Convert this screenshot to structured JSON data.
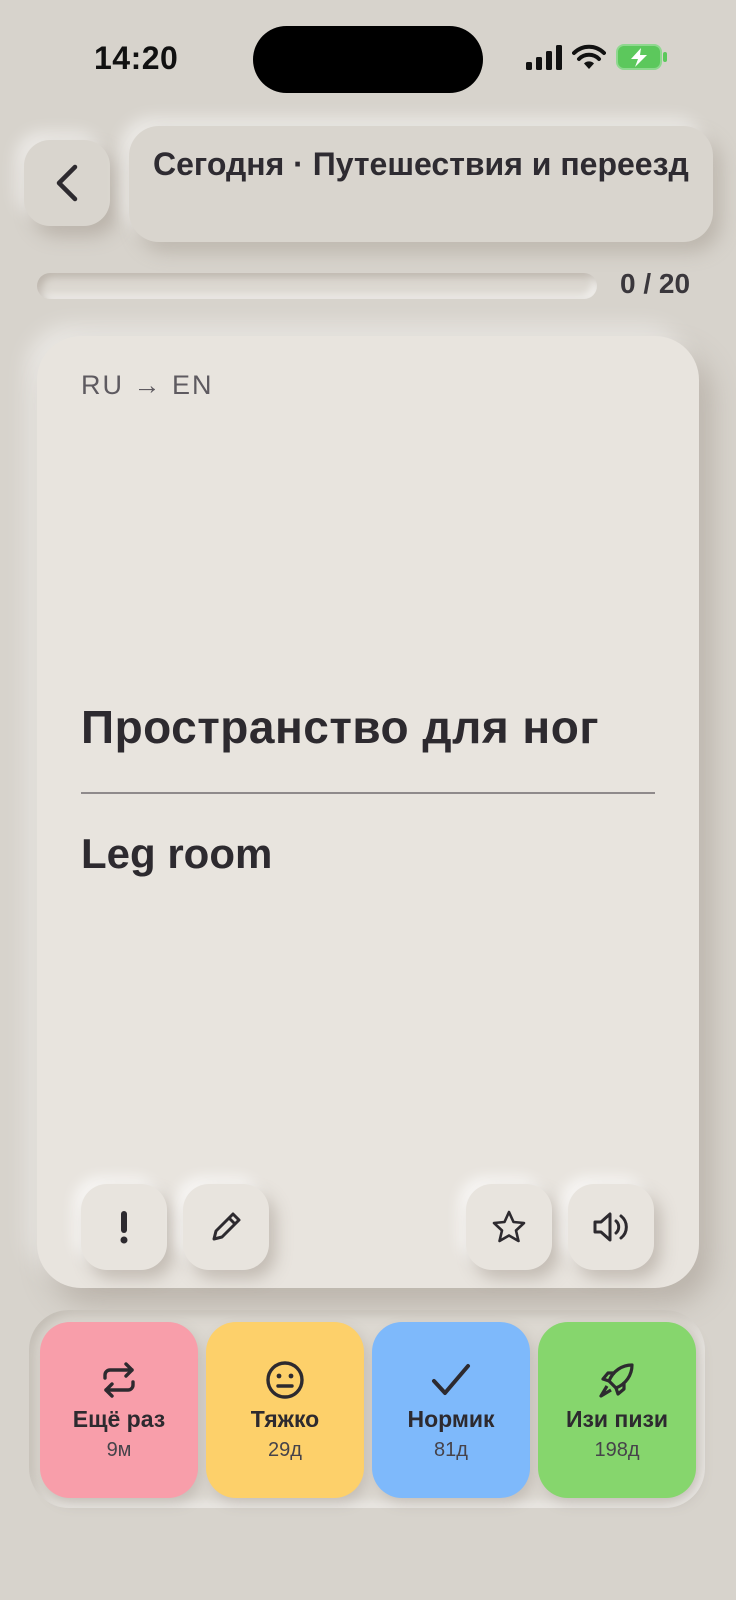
{
  "status_bar": {
    "time": "14:20"
  },
  "header": {
    "title": "Сегодня · Путешествия и переезд"
  },
  "progress": {
    "text": "0 / 20",
    "fraction": 0
  },
  "card": {
    "direction": "RU → EN",
    "front": "Пространство для ног",
    "back": "Leg room",
    "left_buttons": [
      "exclamation-icon",
      "pencil-icon"
    ],
    "right_buttons": [
      "star-icon",
      "speaker-icon"
    ]
  },
  "answers": [
    {
      "label": "Ещё раз",
      "interval": "9м",
      "color": "#f89eaa",
      "icon": "repeat-icon"
    },
    {
      "label": "Тяжко",
      "interval": "29д",
      "color": "#fdd06a",
      "icon": "neutral-face-icon"
    },
    {
      "label": "Нормик",
      "interval": "81д",
      "color": "#7eb9fb",
      "icon": "checkmark-icon"
    },
    {
      "label": "Изи пизи",
      "interval": "198д",
      "color": "#86d66d",
      "icon": "rocket-icon"
    }
  ],
  "colors": {
    "background": "#d7d3cc",
    "card": "#e8e4de",
    "text": "#2d2a2f",
    "battery": "#5cc85c"
  }
}
